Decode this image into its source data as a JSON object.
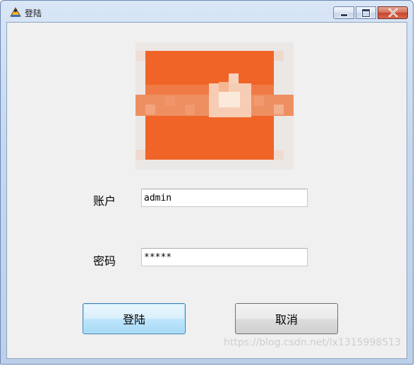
{
  "window": {
    "title": "登陆",
    "app_icon": "app-icon",
    "minimize_icon": "minimize-icon",
    "maximize_icon": "maximize-icon",
    "close_icon": "close-icon"
  },
  "logo": {
    "icon": "logo-image",
    "colors": {
      "primary": "#f06428",
      "highlight": "#fbe9dc"
    }
  },
  "form": {
    "account_label": "账户",
    "account_value": "admin",
    "password_label": "密码",
    "password_value": "*****"
  },
  "buttons": {
    "login_label": "登陆",
    "cancel_label": "取消"
  },
  "watermark": "https://blog.csdn.net/lx1315998513"
}
